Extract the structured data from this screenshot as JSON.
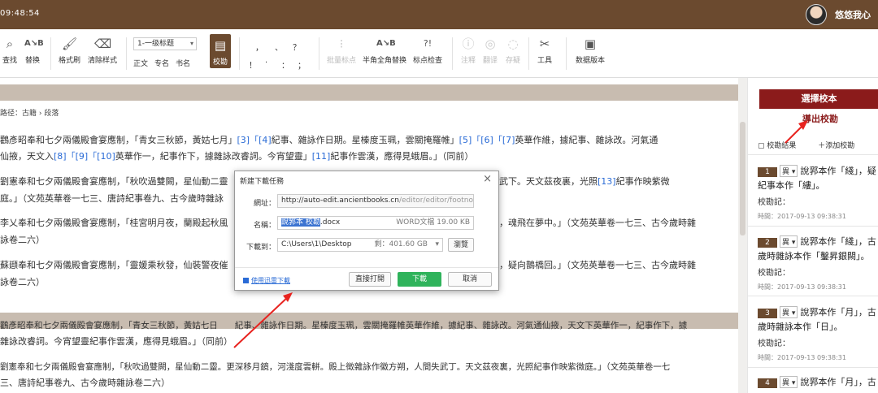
{
  "topbar": {
    "time": "09:48:54",
    "user_name": "悠悠我心"
  },
  "toolbar": {
    "find": "查找",
    "replace": "替换",
    "format_brush": "格式刷",
    "clear_format": "清除样式",
    "heading_select": "1-一级标题",
    "zhengwen": "正文",
    "zhuanming": "专名",
    "shuming": "书名",
    "jiaokan": "校勘",
    "punct_top": [
      "，",
      "、",
      "？"
    ],
    "punct_bottom": [
      "！",
      "·",
      "：",
      "；"
    ],
    "batch_punct": "批量标点",
    "half_full": "半角全角替换",
    "punct_check": "标点检查",
    "annotate": "注释",
    "translate": "翻译",
    "archive": "存疑",
    "tools": "工具",
    "data_version": "数据版本",
    "icons": [
      "search-icon",
      "replace-icon",
      "brush-icon",
      "clear-icon",
      "collate-icon",
      "tools-icon",
      "version-icon"
    ]
  },
  "breadcrumb": "路径：古籍 › 段落",
  "paragraphs": [
    {
      "lines": [
        "鸛彥昭奉和七夕兩儀殿會宴應制，「青女三秋節，黃姑七月」",
        "[3]",
        "「",
        "[4]",
        "紀事、雜詠作日期。星榛度玉珮，雲關掩羅帷」",
        "[5]",
        "「",
        "[6]",
        "「",
        "[7]",
        "英華作維，據紀事、雜詠改。河氣通"
      ]
    },
    {
      "text": "仙掖，天文入",
      "refs": [
        "[8]",
        "[9]",
        "[10]"
      ],
      "tail": "英華作一，紀事作下，據雜詠改睿詞。今宵望靈」",
      "ref2": "[11]",
      "tail2": "紀事作雲漢，應得見蛾眉。」（同前）"
    }
  ],
  "texts": {
    "p1": "鸛彥昭奉和七夕兩儀殿會宴應制，「青女三秋節，黃姑七月」",
    "p1_refs": "[3]「[4]",
    "p1_mid": "紀事、雜詠作日期。星榛度玉珮，雲關掩羅帷」",
    "p1_refs2": "[5]「[6]「[7]",
    "p1_tail": "英華作維，據紀事、雜詠改。河氣通",
    "p2_head": "仙掖，天文入",
    "p2_refs": "[8]「[9]「[10]",
    "p2_mid": "英華作一，紀事作下，據雜詠改睿詞。今宵望靈」",
    "p2_ref": "[11]",
    "p2_tail": "紀事作雲漢，應得見蛾眉。」（同前）",
    "p3_head": "劉憲奉和七夕兩儀殿會宴應制，「秋吹過雙闕，星仙動二靈",
    "p3_tail": "武下。天文茲夜裏，光照",
    "p3_ref": "[13]",
    "p3_end": "紀事作映紫微",
    "p4": "庭。」（文苑英華卷一七三、唐詩紀事卷九、古今歲時雜詠",
    "p5_head": "李乂奉和七夕兩儀殿會宴應制，「桂宮明月夜，蘭殿起秋風",
    "p5_tail": "，魂飛在夢中。」（文苑英華卷一七三、古今歲時雜",
    "p6": "詠卷二六）",
    "p7_head": "蘇頲奉和七夕兩儀殿會宴應制，「靈媛乘秋發，仙裝警夜催",
    "p7_tail": "，疑向鵲橋回。」（文苑英華卷一七三、古今歲時雜",
    "p8": "詠卷二六）",
    "p9": "鸛彥昭奉和七夕兩儀殿會宴應制，「青女三秋節，黃姑七日　　紀事、雜詠作日期。星榛度玉珮，雲關掩羅帷英華作維，據紀事、雜詠改。河氣通仙掖，天文下英華作一，紀事作下，據",
    "p10": "雜詠改睿詞。今宵望靈紀事作雲漢，應得見蛾眉。」（同前）",
    "p11": "劉憲奉和七夕兩儀殿會宴應制，「秋吹過雙闕，星仙動二靈。更深移月鏡，河淺度雲軿。殿上徵雜詠作徽方朔，人間失武丁。天文茲夜裏，光照紀事作映紫微庭。」（文苑英華卷一七",
    "p12": "三、唐詩紀事卷九、古今歲時雜詠卷二六）"
  },
  "right_panel": {
    "select_button": "選擇校本",
    "export_link": "導出校勘",
    "tab_result": "校勘結果",
    "tab_add": "＋添加校勘",
    "cards": [
      {
        "num": "1",
        "tag": "異 ▾",
        "note_line1": "說郛本作「綫」，疑",
        "note_line2": "紀事本作「縷」。",
        "label": "校勘記：",
        "time": "時間：2017-09-13 09:38:31"
      },
      {
        "num": "2",
        "tag": "異 ▾",
        "note_line1": "說郛本作「綫」，古",
        "note_line2": "歲時雜詠本作「鑿昇銀闕」。",
        "label": "校勘記：",
        "time": "時間：2017-09-13 09:38:31"
      },
      {
        "num": "3",
        "tag": "異 ▾",
        "note_line1": "說郛本作「月」，古",
        "note_line2": "歲時雜詠本作「日」。",
        "label": "校勘記：",
        "time": "時間：2017-09-13 09:38:31"
      },
      {
        "num": "4",
        "tag": "異 ▾",
        "note_line1": "說郛本作「月」，古",
        "note_line2": "",
        "label": "",
        "time": ""
      }
    ]
  },
  "dialog": {
    "title": "新建下載任務",
    "url_label": "網址：",
    "url_host": "http://auto-edit.ancientbooks.cn",
    "url_rest": "/editor/editor/footnote/ex",
    "name_label": "名稱：",
    "name_selected": "說郛本 校勘",
    "name_ext": ".docx",
    "file_info": "WORD文檔 19.00 KB",
    "save_label": "下載到：",
    "save_path": "C:\\Users\\1\\Desktop",
    "free_space": "剩：401.60 GB",
    "browse": "瀏覽",
    "thunder_link": "使用迅雷下載",
    "open_direct": "直接打開",
    "download": "下載",
    "cancel": "取消"
  },
  "colors": {
    "brand_brown": "#6b4a2f",
    "select_red": "#8b1b1b",
    "link_blue": "#2a6bd6",
    "download_green": "#2fb35b",
    "arrow_red": "#e8231f"
  }
}
